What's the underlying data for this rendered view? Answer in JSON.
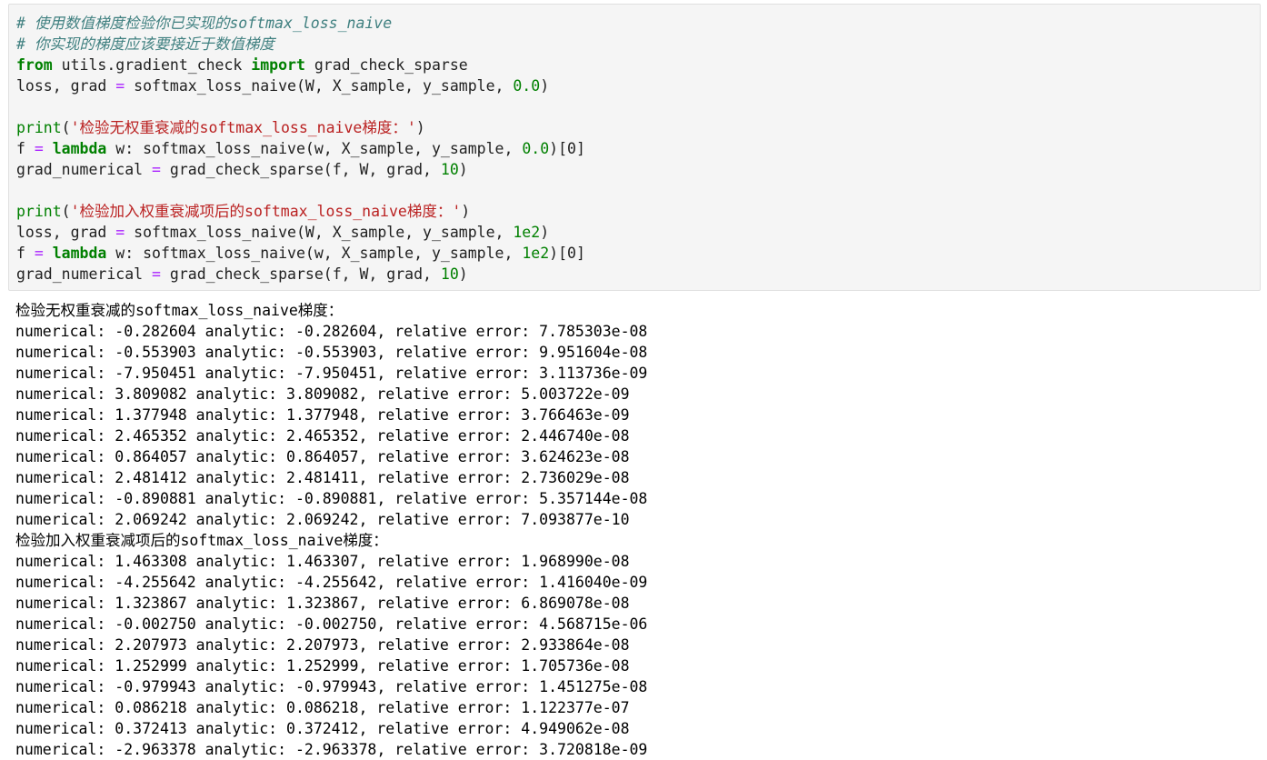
{
  "colors": {
    "cell_background": "#f5f5f5",
    "comment": "#408080",
    "keyword": "#008000",
    "operator": "#aa22ff",
    "number": "#008000",
    "string": "#ba2121"
  },
  "code": {
    "comment_1": "# 使用数值梯度检验你已实现的softmax_loss_naive",
    "comment_2": "# 你实现的梯度应该要接近于数值梯度",
    "kw_from": "from",
    "module": " utils.gradient_check ",
    "kw_import": "import",
    "import_name": " grad_check_sparse",
    "loss_call_1": "loss, grad ",
    "eq": "=",
    "softmax_call_1": " softmax_loss_naive(W, X_sample, y_sample, ",
    "reg_zero": "0.0",
    "close_paren": ")",
    "print_fn": "print",
    "print_str_1": "'检验无权重衰减的softmax_loss_naive梯度：'",
    "f_name": "f ",
    "kw_lambda": "lambda",
    "lambda_body_1": " w: softmax_loss_naive(w, X_sample, y_sample, ",
    "index_zero": ")[0]",
    "grad_numerical": "grad_numerical ",
    "grad_check_call": " grad_check_sparse(f, W, grad, ",
    "num_checks": "10",
    "print_str_2": "'检验加入权重衰减项后的softmax_loss_naive梯度：'",
    "reg_big": "1e2"
  },
  "output": {
    "header_1": "检验无权重衰减的softmax_loss_naive梯度：",
    "lines_1": [
      "numerical: -0.282604 analytic: -0.282604, relative error: 7.785303e-08",
      "numerical: -0.553903 analytic: -0.553903, relative error: 9.951604e-08",
      "numerical: -7.950451 analytic: -7.950451, relative error: 3.113736e-09",
      "numerical: 3.809082 analytic: 3.809082, relative error: 5.003722e-09",
      "numerical: 1.377948 analytic: 1.377948, relative error: 3.766463e-09",
      "numerical: 2.465352 analytic: 2.465352, relative error: 2.446740e-08",
      "numerical: 0.864057 analytic: 0.864057, relative error: 3.624623e-08",
      "numerical: 2.481412 analytic: 2.481411, relative error: 2.736029e-08",
      "numerical: -0.890881 analytic: -0.890881, relative error: 5.357144e-08",
      "numerical: 2.069242 analytic: 2.069242, relative error: 7.093877e-10"
    ],
    "header_2": "检验加入权重衰减项后的softmax_loss_naive梯度：",
    "lines_2": [
      "numerical: 1.463308 analytic: 1.463307, relative error: 1.968990e-08",
      "numerical: -4.255642 analytic: -4.255642, relative error: 1.416040e-09",
      "numerical: 1.323867 analytic: 1.323867, relative error: 6.869078e-08",
      "numerical: -0.002750 analytic: -0.002750, relative error: 4.568715e-06",
      "numerical: 2.207973 analytic: 2.207973, relative error: 2.933864e-08",
      "numerical: 1.252999 analytic: 1.252999, relative error: 1.705736e-08",
      "numerical: -0.979943 analytic: -0.979943, relative error: 1.451275e-08",
      "numerical: 0.086218 analytic: 0.086218, relative error: 1.122377e-07",
      "numerical: 0.372413 analytic: 0.372412, relative error: 4.949062e-08",
      "numerical: -2.963378 analytic: -2.963378, relative error: 3.720818e-09"
    ]
  }
}
